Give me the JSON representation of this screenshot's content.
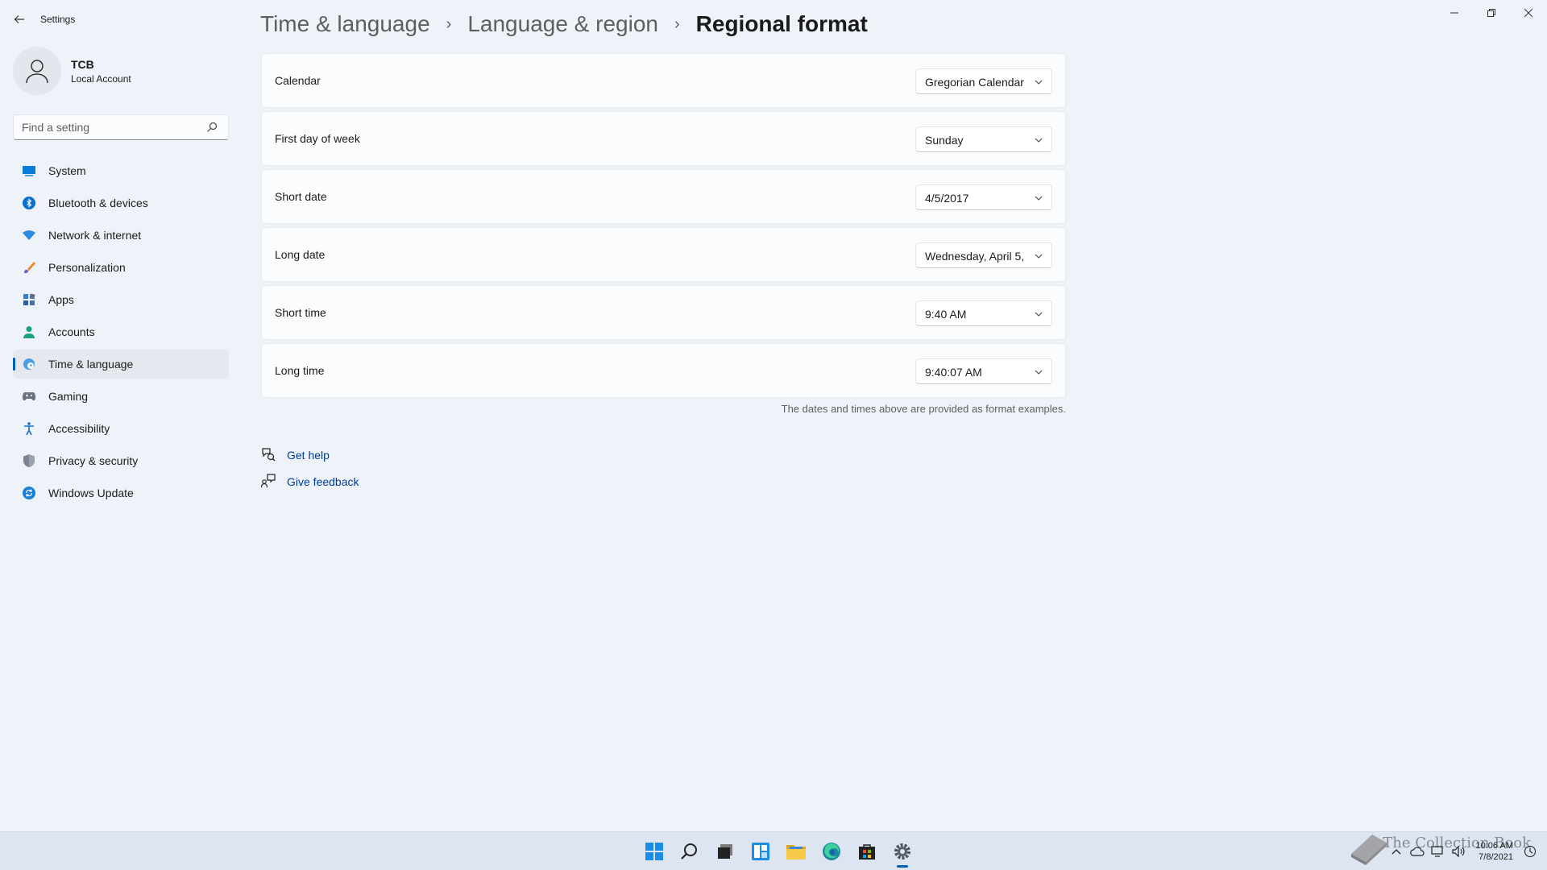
{
  "app": {
    "title": "Settings"
  },
  "profile": {
    "name": "TCB",
    "account_type": "Local Account"
  },
  "search": {
    "placeholder": "Find a setting",
    "value": ""
  },
  "sidebar": {
    "items": [
      {
        "label": "System",
        "icon": "monitor-icon",
        "active": false
      },
      {
        "label": "Bluetooth & devices",
        "icon": "bluetooth-icon",
        "active": false
      },
      {
        "label": "Network & internet",
        "icon": "wifi-icon",
        "active": false
      },
      {
        "label": "Personalization",
        "icon": "brush-icon",
        "active": false
      },
      {
        "label": "Apps",
        "icon": "apps-icon",
        "active": false
      },
      {
        "label": "Accounts",
        "icon": "person-icon",
        "active": false
      },
      {
        "label": "Time & language",
        "icon": "globe-clock-icon",
        "active": true
      },
      {
        "label": "Gaming",
        "icon": "gamepad-icon",
        "active": false
      },
      {
        "label": "Accessibility",
        "icon": "accessibility-icon",
        "active": false
      },
      {
        "label": "Privacy & security",
        "icon": "shield-icon",
        "active": false
      },
      {
        "label": "Windows Update",
        "icon": "update-icon",
        "active": false
      }
    ]
  },
  "breadcrumb": {
    "items": [
      "Time & language",
      "Language & region",
      "Regional format"
    ]
  },
  "settings": {
    "rows": [
      {
        "label": "Calendar",
        "value": "Gregorian Calendar"
      },
      {
        "label": "First day of week",
        "value": "Sunday"
      },
      {
        "label": "Short date",
        "value": "4/5/2017"
      },
      {
        "label": "Long date",
        "value": "Wednesday, April 5,"
      },
      {
        "label": "Short time",
        "value": "9:40 AM"
      },
      {
        "label": "Long time",
        "value": "9:40:07 AM"
      }
    ],
    "note": "The dates and times above are provided as format examples."
  },
  "help": {
    "get_help": "Get help",
    "give_feedback": "Give feedback"
  },
  "taskbar": {
    "apps": [
      "windows-start-icon",
      "search-icon",
      "task-view-icon",
      "widgets-icon",
      "file-explorer-icon",
      "edge-icon",
      "store-icon",
      "settings-gear-icon"
    ],
    "clock_time": "10:06 AM",
    "clock_date": "7/8/2021",
    "watermark": "The Collection Book"
  },
  "colors": {
    "accent": "#005fb8",
    "link": "#003e92",
    "background": "#eef2f9"
  }
}
